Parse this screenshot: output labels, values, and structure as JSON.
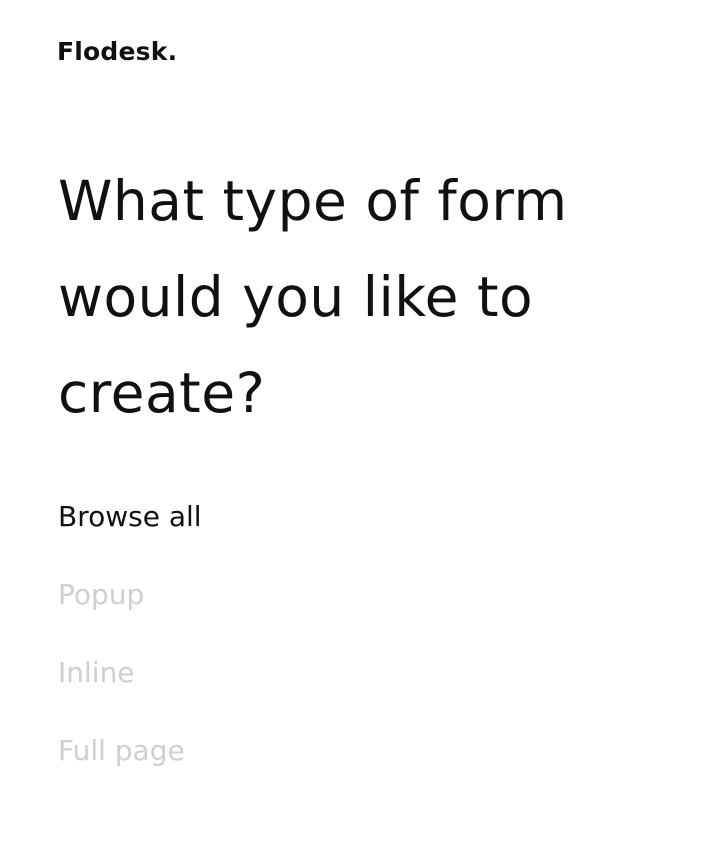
{
  "header": {
    "logo_text": "Flodesk."
  },
  "main": {
    "title": "What type of form would you like to create?"
  },
  "filters": {
    "items": [
      {
        "label": "Browse all",
        "state": "active"
      },
      {
        "label": "Popup",
        "state": "inactive"
      },
      {
        "label": "Inline",
        "state": "inactive"
      },
      {
        "label": "Full page",
        "state": "inactive"
      }
    ]
  },
  "colors": {
    "text": "#111111",
    "inactive_text": "#cfcfcf",
    "background": "#ffffff"
  }
}
